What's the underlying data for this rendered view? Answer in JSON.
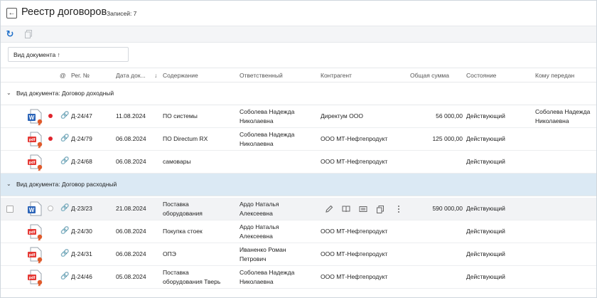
{
  "header": {
    "title": "Реестр договоров",
    "count_label": "Записей: 7",
    "back_icon": "arrow-left-icon"
  },
  "toolbar": {
    "refresh_icon": "refresh-icon",
    "copy_icon": "copy-icon"
  },
  "grouping": {
    "label": "Вид документа ↑"
  },
  "columns": {
    "at": "@",
    "reg_no": "Рег. №",
    "date": "Дата док...",
    "sort_arrow": "↓",
    "content": "Содержание",
    "responsible": "Ответственный",
    "counterparty": "Контрагент",
    "total": "Общая сумма",
    "state": "Состояние",
    "handed_to": "Кому передан"
  },
  "groups": [
    {
      "label": "Вид документа: Договор доходный",
      "rows": [
        {
          "icon": "word-doc-icon",
          "marker": "red",
          "reg_no": "Д-24/47",
          "date": "11.08.2024",
          "content_1": "ПО системы",
          "content_2": "",
          "resp_1": "Соболева Надежда",
          "resp_2": "Николаевна",
          "counterparty": "Директум ООО",
          "total": "56 000,00",
          "state": "Действующий",
          "handed_1": "Соболева Надежда",
          "handed_2": "Николаевна"
        },
        {
          "icon": "pdf-doc-icon",
          "marker": "red",
          "reg_no": "Д-24/79",
          "date": "06.08.2024",
          "content_1": "ПО Directum RX",
          "content_2": "",
          "resp_1": "Соболева Надежда",
          "resp_2": "Николаевна",
          "counterparty": "ООО МТ-Нефтепродукт",
          "total": "125 000,00",
          "state": "Действующий",
          "handed_1": "",
          "handed_2": ""
        },
        {
          "icon": "pdf-doc-icon",
          "marker": "none",
          "reg_no": "Д-24/68",
          "date": "06.08.2024",
          "content_1": "самовары",
          "content_2": "",
          "resp_1": "",
          "resp_2": "",
          "counterparty": "ООО МТ-Нефтепродукт",
          "total": "",
          "state": "Действующий",
          "handed_1": "",
          "handed_2": ""
        }
      ]
    },
    {
      "label": "Вид документа: Договор расходный",
      "rows": [
        {
          "icon": "word-doc-icon",
          "marker": "empty",
          "reg_no": "Д-23/23",
          "date": "21.08.2024",
          "content_1": "Поставка",
          "content_2": "оборудования",
          "resp_1": "Ардо Наталья",
          "resp_2": "Алексеевна",
          "counterparty": "",
          "total": "590 000,00",
          "state": "Действующий",
          "handed_1": "",
          "handed_2": ""
        },
        {
          "icon": "pdf-doc-icon",
          "marker": "none",
          "reg_no": "Д-24/30",
          "date": "06.08.2024",
          "content_1": "Покупка стоек",
          "content_2": "",
          "resp_1": "Ардо Наталья",
          "resp_2": "Алексеевна",
          "counterparty": "ООО МТ-Нефтепродукт",
          "total": "",
          "state": "Действующий",
          "handed_1": "",
          "handed_2": ""
        },
        {
          "icon": "pdf-doc-icon",
          "marker": "none",
          "reg_no": "Д-24/31",
          "date": "06.08.2024",
          "content_1": "ОПЭ",
          "content_2": "",
          "resp_1": "Иваненко Роман",
          "resp_2": "Петрович",
          "counterparty": "ООО МТ-Нефтепродукт",
          "total": "",
          "state": "Действующий",
          "handed_1": "",
          "handed_2": ""
        },
        {
          "icon": "pdf-doc-icon",
          "marker": "none",
          "reg_no": "Д-24/46",
          "date": "05.08.2024",
          "content_1": "Поставка",
          "content_2": "оборудования Тверь",
          "resp_1": "Соболева Надежда",
          "resp_2": "Николаевна",
          "counterparty": "ООО МТ-Нефтепродукт",
          "total": "",
          "state": "Действующий",
          "handed_1": "",
          "handed_2": ""
        }
      ]
    }
  ],
  "row_actions": [
    "edit-icon",
    "book-icon",
    "card-icon",
    "copy-icon",
    "more-icon"
  ],
  "colors": {
    "accent": "#1f6fc9",
    "selected_group": "#dbe9f4",
    "marker_red": "#e0242c",
    "pdf_red": "#e53935",
    "word_blue": "#2b64b8"
  }
}
